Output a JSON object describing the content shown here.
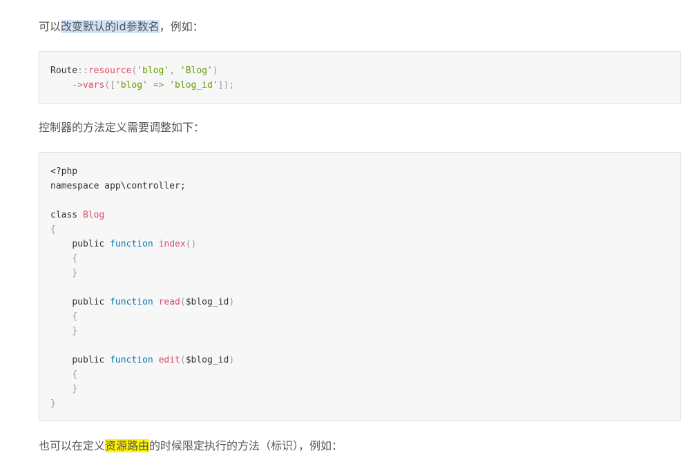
{
  "paragraphs": {
    "p1": {
      "prefix": "可以",
      "selected": "改变默认的id参数名",
      "suffix": "，例如："
    },
    "p2": {
      "text": "控制器的方法定义需要调整如下："
    },
    "p3": {
      "prefix": "也可以在定义",
      "highlighted": "资源路由",
      "suffix": "的时候限定执行的方法（标识），例如："
    }
  },
  "code1": {
    "l1": {
      "a": "Route",
      "b": "::",
      "c": "resource",
      "d": "(",
      "e": "'blog'",
      "f": ", ",
      "g": "'Blog'",
      "h": ")"
    },
    "l2": {
      "indent": "    ",
      "a": "->",
      "b": "vars",
      "c": "([",
      "d": "'blog'",
      "e": " ",
      "f": "=>",
      "g": " ",
      "h": "'blog_id'",
      "i": "]);"
    }
  },
  "code2": {
    "l1": "<?php",
    "l2": "namespace app\\controller;",
    "l4": {
      "kw": "class",
      "sp": " ",
      "name": "Blog"
    },
    "l5": "{",
    "methods": [
      {
        "public": "public",
        "function": "function",
        "name": "index",
        "args": "()",
        "open": "{",
        "close": "}"
      },
      {
        "public": "public",
        "function": "function",
        "name": "read",
        "args_open": "(",
        "arg": "$blog_id",
        "args_close": ")",
        "open": "{",
        "close": "}"
      },
      {
        "public": "public",
        "function": "function",
        "name": "edit",
        "args_open": "(",
        "arg": "$blog_id",
        "args_close": ")",
        "open": "{",
        "close": "}"
      }
    ],
    "last": "}"
  }
}
